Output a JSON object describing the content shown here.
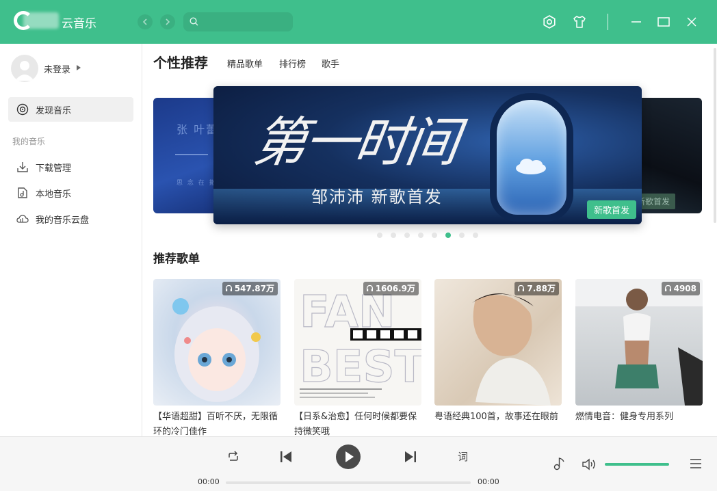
{
  "app": {
    "title": "云音乐",
    "accent_color": "#3fbf8c"
  },
  "titlebar": {
    "back_icon": "chevron-left-icon",
    "forward_icon": "chevron-right-icon",
    "search_placeholder": "",
    "icons": [
      "settings-icon",
      "skin-tshirt-icon",
      "minimize-icon",
      "maximize-icon",
      "close-icon"
    ]
  },
  "sidebar": {
    "login_label": "未登录",
    "discover_label": "发现音乐",
    "section_label": "我的音乐",
    "items": [
      {
        "label": "下载管理",
        "icon": "download-icon"
      },
      {
        "label": "本地音乐",
        "icon": "local-music-icon"
      },
      {
        "label": "我的音乐云盘",
        "icon": "cloud-icon"
      }
    ]
  },
  "main": {
    "page_title": "个性推荐",
    "tabs": [
      "精品歌单",
      "排行榜",
      "歌手"
    ],
    "banner": {
      "calligraphy": "第一时间",
      "subtitle": "邹沛沛  新歌首发",
      "tag": "新歌首发",
      "side_tag": "新歌首发",
      "left_text": "张 叶蕾",
      "left_small": "思 念 在 撒",
      "dot_count": 8,
      "active_dot": 5
    },
    "section_title": "推荐歌单",
    "playlists": [
      {
        "title": "【华语超甜】百听不厌，无限循环的冷门佳作",
        "plays": "547.87万"
      },
      {
        "title": "【日系&治愈】任何时候都要保持微笑哦",
        "plays": "1606.9万"
      },
      {
        "title": "粤语经典100首，故事还在眼前",
        "plays": "7.88万"
      },
      {
        "title": "燃情电音：健身专用系列",
        "plays": "4908"
      }
    ]
  },
  "player": {
    "current_time": "00:00",
    "total_time": "00:00",
    "lyric_label": "词",
    "progress": 0,
    "volume": 1.0
  }
}
